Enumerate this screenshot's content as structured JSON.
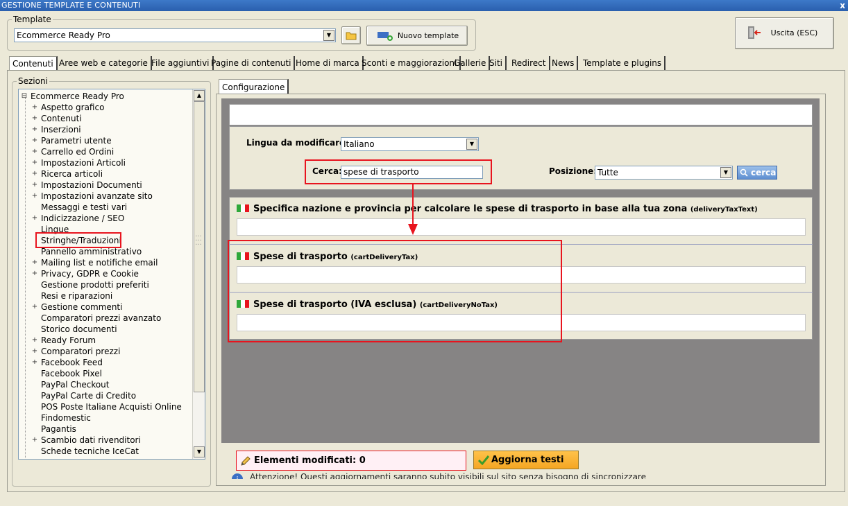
{
  "window": {
    "title": "GESTIONE TEMPLATE E CONTENUTI",
    "close_glyph": "x"
  },
  "template_group": {
    "legend": "Template",
    "selected": "Ecommerce Ready Pro",
    "new_button": "Nuovo template"
  },
  "exit_button": {
    "label": "Uscita (ESC)"
  },
  "tabs": [
    "Contenuti",
    "Aree web e categorie",
    "File aggiuntivi",
    "Pagine di contenuti",
    "Home di marca",
    "Sconti e maggiorazioni",
    "Gallerie",
    "Siti",
    "Redirect",
    "News",
    "Template e plugins"
  ],
  "sections": {
    "legend": "Sezioni",
    "root": "Ecommerce Ready Pro",
    "items": [
      {
        "label": "Aspetto grafico",
        "expandable": true
      },
      {
        "label": "Contenuti",
        "expandable": true
      },
      {
        "label": "Inserzioni",
        "expandable": true
      },
      {
        "label": "Parametri utente",
        "expandable": true
      },
      {
        "label": "Carrello ed Ordini",
        "expandable": true
      },
      {
        "label": "Impostazioni Articoli",
        "expandable": true
      },
      {
        "label": "Ricerca articoli",
        "expandable": true
      },
      {
        "label": "Impostazioni Documenti",
        "expandable": true
      },
      {
        "label": "Impostazioni avanzate sito",
        "expandable": true
      },
      {
        "label": "Messaggi e testi vari",
        "expandable": false
      },
      {
        "label": "Indicizzazione / SEO",
        "expandable": true
      },
      {
        "label": "Lingue",
        "expandable": false
      },
      {
        "label": "Stringhe/Traduzioni",
        "expandable": false,
        "highlighted": true
      },
      {
        "label": "Pannello amministrativo",
        "expandable": false
      },
      {
        "label": "Mailing list e notifiche email",
        "expandable": true
      },
      {
        "label": "Privacy, GDPR e Cookie",
        "expandable": true
      },
      {
        "label": "Gestione prodotti preferiti",
        "expandable": false
      },
      {
        "label": "Resi e riparazioni",
        "expandable": false
      },
      {
        "label": "Gestione commenti",
        "expandable": true
      },
      {
        "label": "Comparatori prezzi avanzato",
        "expandable": false
      },
      {
        "label": "Storico documenti",
        "expandable": false
      },
      {
        "label": "Ready Forum",
        "expandable": true
      },
      {
        "label": "Comparatori prezzi",
        "expandable": true
      },
      {
        "label": "Facebook Feed",
        "expandable": true
      },
      {
        "label": "Facebook Pixel",
        "expandable": false
      },
      {
        "label": "PayPal Checkout",
        "expandable": false
      },
      {
        "label": "PayPal Carte di Credito",
        "expandable": false
      },
      {
        "label": "POS Poste Italiane Acquisti Online",
        "expandable": false
      },
      {
        "label": "Findomestic",
        "expandable": false
      },
      {
        "label": "Pagantis",
        "expandable": false
      },
      {
        "label": "Scambio dati rivenditori",
        "expandable": true
      },
      {
        "label": "Schede tecniche IceCat",
        "expandable": false
      }
    ]
  },
  "config": {
    "tab": "Configurazione",
    "language_label": "Lingua da modificare:",
    "language_value": "Italiano",
    "search_label": "Cerca:",
    "search_value": "spese di trasporto",
    "position_label": "Posizione:",
    "position_value": "Tutte",
    "search_button": "cerca",
    "results": [
      {
        "title": "Specifica nazione e provincia per calcolare le spese di trasporto in base alla tua zona",
        "key": "(deliveryTaxText)",
        "value": ""
      },
      {
        "title": "Spese di trasporto",
        "key": "(cartDeliveryTax)",
        "value": ""
      },
      {
        "title": "Spese di trasporto (IVA esclusa)",
        "key": "(cartDeliveryNoTax)",
        "value": ""
      }
    ]
  },
  "footer": {
    "modified_label": "Elementi modificati: 0",
    "update_button": "Aggiorna testi",
    "notice": "Attenzione! Questi aggiornamenti saranno subito visibili sul sito senza bisogno di sincronizzare"
  },
  "colors": {
    "titlebar": "#2a5fae",
    "highlight": "#e8141e",
    "panel_gray": "#868484",
    "modified_bg": "#fff0f5",
    "update_bg": "#f5a623"
  },
  "icons": [
    "close-icon",
    "folder-icon",
    "new-template-icon",
    "exit-door-icon",
    "plus-icon",
    "minus-icon",
    "flag-italy-icon",
    "magnifier-icon",
    "pencil-icon",
    "checkmark-icon",
    "info-icon",
    "arrow-down-icon"
  ]
}
